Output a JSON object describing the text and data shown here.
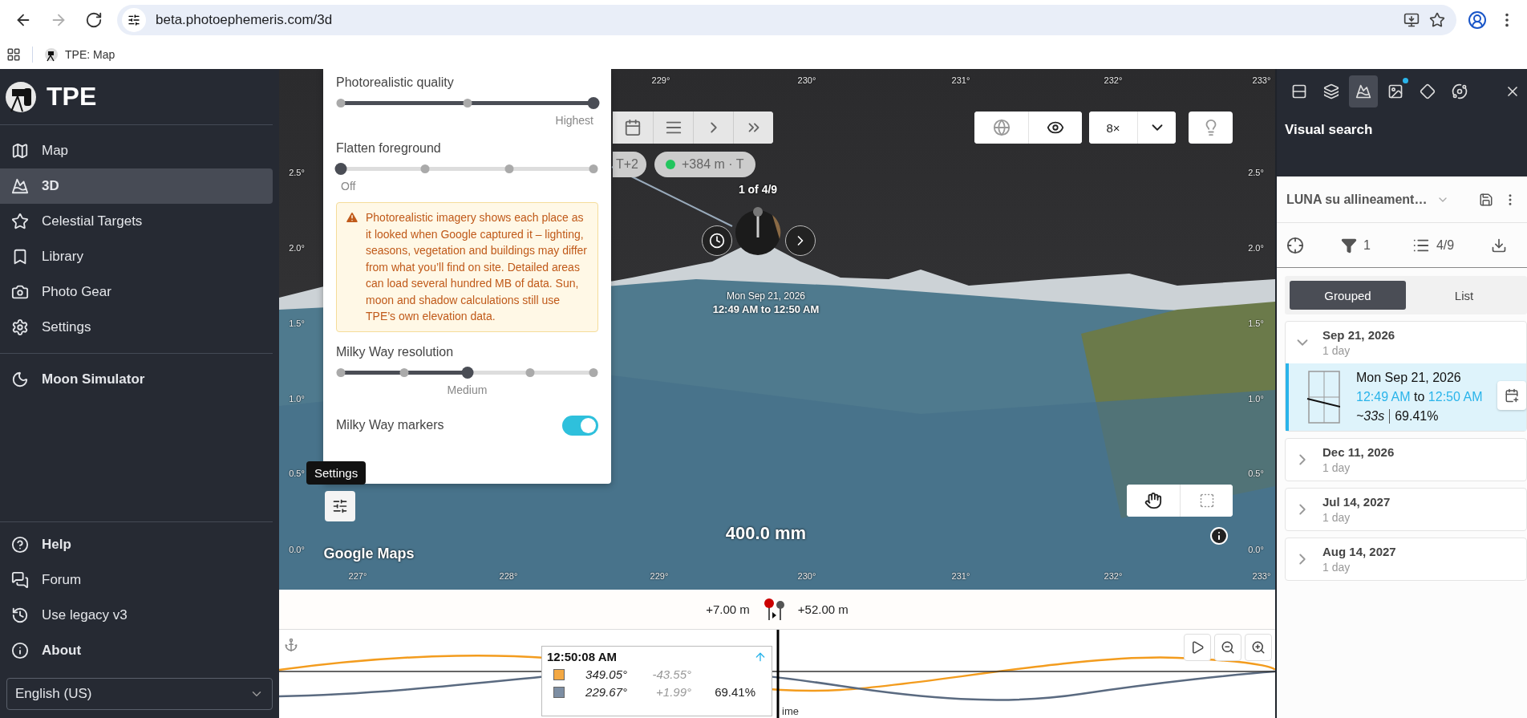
{
  "browser": {
    "nav": [
      {
        "kind": "back",
        "disabled": false
      },
      {
        "kind": "forward",
        "disabled": true
      },
      {
        "kind": "reload",
        "disabled": false
      }
    ],
    "url": "beta.photoephemeris.com/3d",
    "bookmarks": [
      {
        "label": "TPE: Map"
      }
    ]
  },
  "sidebar": {
    "brand": "TPE",
    "items": [
      {
        "label": "Map",
        "selected": false
      },
      {
        "label": "3D",
        "selected": true
      },
      {
        "label": "Celestial Targets",
        "selected": false
      },
      {
        "label": "Library",
        "selected": false
      },
      {
        "label": "Photo Gear",
        "selected": false
      },
      {
        "label": "Settings",
        "selected": false
      }
    ],
    "extras": [
      {
        "label": "Moon Simulator",
        "selected": false
      }
    ],
    "footer": [
      {
        "label": "Help",
        "bold": true
      },
      {
        "label": "Forum",
        "bold": false
      },
      {
        "label": "Use legacy v3",
        "bold": false
      },
      {
        "label": "About",
        "bold": true
      }
    ],
    "language": "English (US)"
  },
  "map": {
    "top_ticks": [
      "229°",
      "230°",
      "231°",
      "232°",
      "233°"
    ],
    "bottom_ticks": [
      "227°",
      "228°",
      "229°",
      "230°",
      "231°",
      "232°",
      "233°"
    ],
    "left_ticks": [
      "2.5°",
      "2.0°",
      "1.5°",
      "1.0°",
      "0.5°",
      "0.0°"
    ],
    "right_ticks": [
      "2.5°",
      "2.0°",
      "1.5°",
      "1.0°",
      "0.5°",
      "0.0°"
    ],
    "toolbar": [
      {
        "kind": "calendar"
      },
      {
        "kind": "list"
      },
      {
        "kind": "next"
      },
      {
        "kind": "last"
      }
    ],
    "chips": [
      {
        "label": "T+2"
      },
      {
        "label": "+384 m · T",
        "color": "#22c55e"
      }
    ],
    "view_buttons": [
      {
        "kind": "globe",
        "on": false
      },
      {
        "kind": "eye",
        "on": true
      }
    ],
    "zoom": "8×",
    "marker": {
      "label": "1 of 4/9",
      "date": "Mon Sep 21, 2026",
      "time": "12:49 AM to 12:50 AM"
    },
    "focal_length": "400.0 mm",
    "attribution": "Google Maps",
    "tooltip": "Settings",
    "settings": {
      "sections": [
        {
          "kind": "slider3",
          "title": "Photorealistic quality",
          "level": 1,
          "value": "Highest"
        },
        {
          "kind": "slider4",
          "title": "Flatten foreground",
          "level": 0,
          "value": "Off"
        },
        {
          "kind": "warning",
          "text": "Photorealistic imagery shows each place as it looked when Google captured it – lighting, seasons, vegetation and buildings may differ from what you’ll find on site. Detailed areas can load several hundred MB of data. Sun, moon and shadow calculations still use TPE’s own elevation data."
        },
        {
          "kind": "slider5",
          "title": "Milky Way resolution",
          "level": 0.5,
          "value": "Medium"
        },
        {
          "kind": "toggle",
          "title": "Milky Way markers",
          "on": true
        }
      ]
    }
  },
  "elevation": {
    "left": "+7.00 m",
    "right": "+52.00 m"
  },
  "timeline": {
    "readout": {
      "time": "12:50:08 AM",
      "rows": [
        {
          "color": "#f3a843",
          "azimuth": "349.05°",
          "altitude": "-43.55°"
        },
        {
          "color": "#7d8ea3",
          "azimuth": "229.67°",
          "altitude": "+1.99°",
          "illumination": "69.41%"
        }
      ]
    },
    "axis_label": "ime"
  },
  "panel": {
    "tabs": [
      {
        "kind": "rows",
        "selected": false,
        "badge": false
      },
      {
        "kind": "layers",
        "selected": false,
        "badge": false
      },
      {
        "kind": "city",
        "selected": true,
        "badge": false
      },
      {
        "kind": "image",
        "selected": false,
        "badge": true
      },
      {
        "kind": "diamond",
        "selected": false,
        "badge": false
      },
      {
        "kind": "planet",
        "selected": false,
        "badge": false
      }
    ],
    "title": "Visual search",
    "search_name": "LUNA su allineament…",
    "filter_count": "1",
    "result_count": "4/9",
    "modes": [
      {
        "label": "Grouped",
        "selected": true
      },
      {
        "label": "List",
        "selected": false
      }
    ],
    "groups": [
      {
        "date": "Sep 21, 2026",
        "span": "1 day",
        "expanded": true,
        "results": [
          {
            "date": "Mon Sep 21, 2026",
            "start": "12:49 AM",
            "joiner": "to",
            "end": "12:50 AM",
            "duration": "~33s",
            "illumination": "69.41%",
            "selected": true
          }
        ]
      },
      {
        "date": "Dec 11, 2026",
        "span": "1 day",
        "expanded": false
      },
      {
        "date": "Jul 14, 2027",
        "span": "1 day",
        "expanded": false
      },
      {
        "date": "Aug 14, 2027",
        "span": "1 day",
        "expanded": false
      }
    ]
  }
}
